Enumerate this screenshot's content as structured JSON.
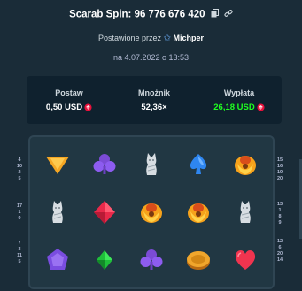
{
  "header": {
    "title": "Scarab Spin: 96 776 676 420",
    "copy_icon": "copy-icon",
    "link_icon": "link-icon"
  },
  "subheader": {
    "posted_by_label": "Postawione przez",
    "user_icon": "star-icon",
    "username": "Michper",
    "date": "na 4.07.2022 o 13:53"
  },
  "stats": {
    "bet": {
      "label": "Postaw",
      "value": "0,50 USD"
    },
    "multiplier": {
      "label": "Mnożnik",
      "value": "52,36×"
    },
    "payout": {
      "label": "Wypłata",
      "value": "26,18 USD"
    }
  },
  "currency_icon": "ruby-gem-icon",
  "colors": {
    "background": "#1a2c38",
    "panel": "#0f212e",
    "board": "#213743",
    "payout_green": "#1fff20"
  },
  "left_paylines": {
    "top": [
      "4",
      "10",
      "2",
      "5"
    ],
    "middle": [
      "17",
      "1",
      "9"
    ],
    "bottom": [
      "7",
      "3",
      "11",
      "5"
    ]
  },
  "right_paylines": {
    "top": [
      "15",
      "16",
      "19",
      "20"
    ],
    "middle": [
      "13",
      "1",
      "8",
      "9"
    ],
    "bottom": [
      "12",
      "6",
      "20",
      "14"
    ]
  },
  "reels": [
    [
      "gold-triangle-icon",
      "purple-club-icon",
      "white-mummy-cat-icon",
      "blue-spade-icon",
      "golden-scarab-icon"
    ],
    [
      "white-mummy-cat-icon",
      "red-diamond-icon",
      "golden-scarab-icon",
      "golden-scarab-icon",
      "white-mummy-cat-icon"
    ],
    [
      "purple-pentagon-icon",
      "green-diamond-icon",
      "purple-club-icon",
      "gold-coin-icon",
      "red-heart-icon"
    ]
  ]
}
